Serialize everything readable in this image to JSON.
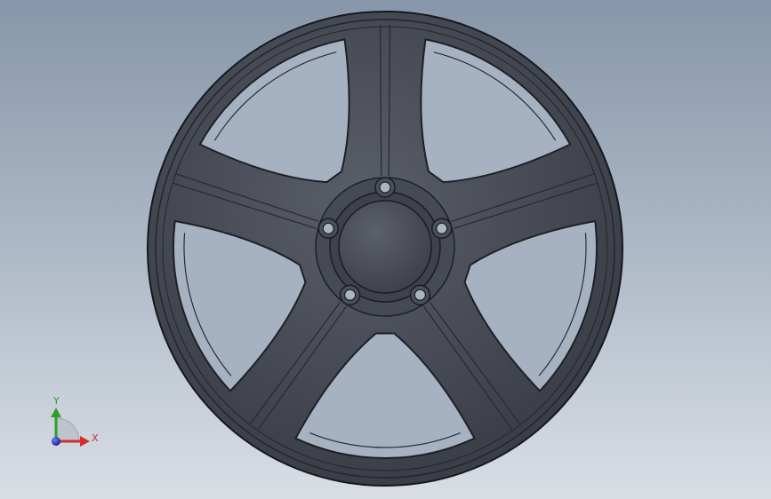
{
  "viewport": {
    "background_top": "#8796aa",
    "background_bottom": "#d9dee5"
  },
  "model": {
    "part": "wheel-rim",
    "spoke_count": 5,
    "lug_hole_count": 5,
    "body_color": "#454953",
    "edge_color": "#16181d"
  },
  "triad": {
    "y_label": "Y",
    "x_label": "X",
    "y_color": "#2aa02a",
    "x_color": "#d42a2a",
    "z_color": "#1f35c8"
  }
}
